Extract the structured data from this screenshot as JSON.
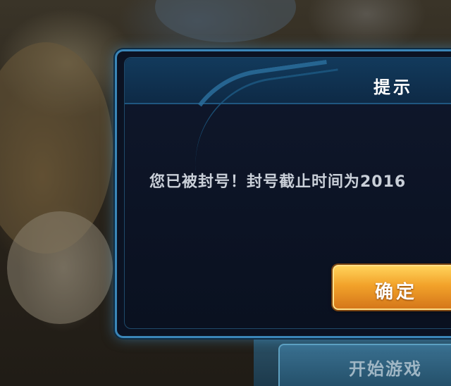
{
  "dialog": {
    "title": "提示",
    "message": "您已被封号！封号截止时间为2016",
    "confirm_label": "确定"
  },
  "background": {
    "start_game_label": "开始游戏"
  },
  "colors": {
    "dialog_border": "#3b86b8",
    "dialog_bg": "#0b1222",
    "confirm_gold": "#f2a22a",
    "title_text": "#ffffff",
    "message_text": "#c9cfd8"
  }
}
